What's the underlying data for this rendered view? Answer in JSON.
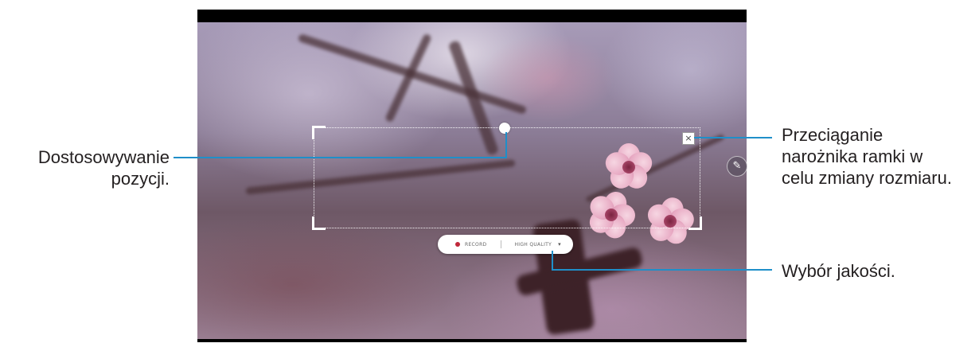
{
  "callouts": {
    "position": [
      "Dostosowywanie",
      "pozycji."
    ],
    "resize": [
      "Przeciąganie",
      "narożnika ramki w",
      "celu zmiany rozmiaru."
    ],
    "quality": "Wybór jakości."
  },
  "toolbar": {
    "record_label": "RECORD",
    "quality_label": "HIGH QUALITY",
    "quality_arrow": "▾"
  },
  "controls": {
    "close_glyph": "×",
    "pen_glyph": "✎"
  },
  "colors": {
    "callout_line": "#1f8fc9",
    "record_dot": "#c0283a"
  }
}
